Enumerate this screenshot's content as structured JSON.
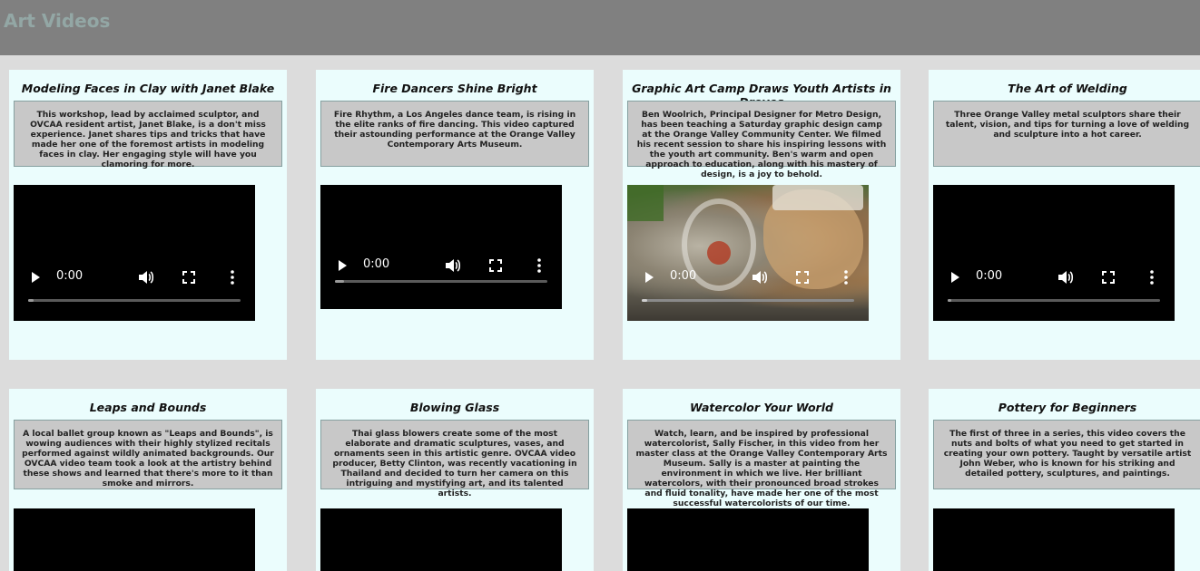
{
  "header": {
    "title": "Art Videos",
    "background": "#808080",
    "title_color": "#93a7a5"
  },
  "colors": {
    "page_background": "#dcdcdc",
    "card_background": "#ebfdfd",
    "description_background": "#c8c8c8"
  },
  "player": {
    "time": "0:00",
    "progress": 0,
    "icons": [
      "play-icon",
      "volume-icon",
      "fullscreen-icon",
      "menu-icon"
    ]
  },
  "videos": [
    {
      "title": "Modeling Faces in Clay with Janet Blake",
      "description": "This workshop, lead by acclaimed sculptor, and OVCAA resident artist, Janet Blake, is a don't miss experience. Janet shares tips and tricks that have made her one of the foremost artists in modeling faces in clay. Her engaging style will have you clamoring for more."
    },
    {
      "title": "Fire Dancers Shine Bright",
      "description": "Fire Rhythm, a Los Angeles dance team, is rising in the elite ranks of fire dancing. This video captured their astounding performance at the Orange Valley Contemporary Arts Museum."
    },
    {
      "title": "Graphic Art Camp Draws Youth Artists in Droves",
      "description": "Ben Woolrich, Principal Designer for Metro Design, has been teaching a Saturday graphic design camp at the Orange Valley Community Center. We filmed his recent session to share his inspiring lessons with the youth art community. Ben's warm and open approach to education, along with his mastery of design, is a joy to behold."
    },
    {
      "title": "The Art of Welding",
      "description": "Three Orange Valley metal sculptors share their talent, vision, and tips for turning a love of welding and sculpture into a hot career."
    },
    {
      "title": "Leaps and Bounds",
      "description": "A local ballet group known as \"Leaps and Bounds\", is wowing audiences with their highly stylized recitals performed against wildly animated backgrounds. Our OVCAA video team took a look at the artistry behind these shows and learned that there's more to it than smoke and mirrors."
    },
    {
      "title": "Blowing Glass",
      "description": "Thai glass blowers create some of the most elaborate and dramatic sculptures, vases, and ornaments seen in this artistic genre. OVCAA video producer, Betty Clinton, was recently vacationing in Thailand and decided to turn her camera on this intriguing and mystifying art, and its talented artists."
    },
    {
      "title": "Watercolor Your World",
      "description": "Watch, learn, and be inspired by professional watercolorist, Sally Fischer, in this video from her master class at the Orange Valley Contemporary Arts Museum. Sally is a master at painting the environment in which we live. Her brilliant watercolors, with their pronounced broad strokes and fluid tonality, have made her one of the most successful watercolorists of our time."
    },
    {
      "title": "Pottery for Beginners",
      "description": "The first of three in a series, this video covers the nuts and bolts of what you need to get started in creating your own pottery. Taught by versatile artist John Weber, who is known for his striking and detailed pottery, sculptures, and paintings."
    }
  ]
}
